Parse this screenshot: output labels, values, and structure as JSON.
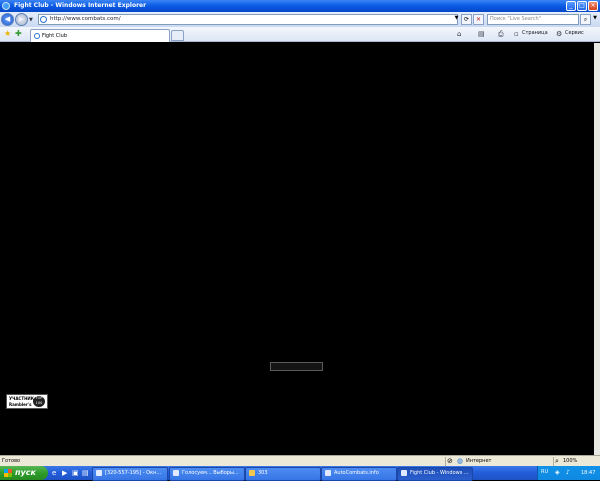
{
  "window": {
    "title": "Fight Club - Windows Internet Explorer"
  },
  "address_bar": {
    "url": "http://www.combats.com/",
    "search_placeholder": "Поиск \"Live Search\""
  },
  "tabs": [
    {
      "label": "Fight Club"
    }
  ],
  "command_bar": {
    "page_label": "Страница",
    "tools_label": "Сервис"
  },
  "content": {
    "badge": {
      "line1": "УЧАСТНИК",
      "line2": "Rambler's",
      "top": "TOP 100"
    }
  },
  "status_bar": {
    "text": "Готово",
    "zone": "Интернет",
    "zoom": "100%"
  },
  "taskbar": {
    "start_label": "пуск",
    "tasks": [
      {
        "label": "[320-557-195] - Окн..."
      },
      {
        "label": "Голосуем... Выборы..."
      },
      {
        "label": "303"
      },
      {
        "label": "AutoCombats.info"
      },
      {
        "label": "Fight Club - Windows ..."
      }
    ],
    "language": "RU",
    "clock": "18:47"
  },
  "colors": {
    "title_bar": "#0a5ae4",
    "taskbar": "#245edb",
    "start_button": "#2e9c2a",
    "page_background": "#000000"
  }
}
